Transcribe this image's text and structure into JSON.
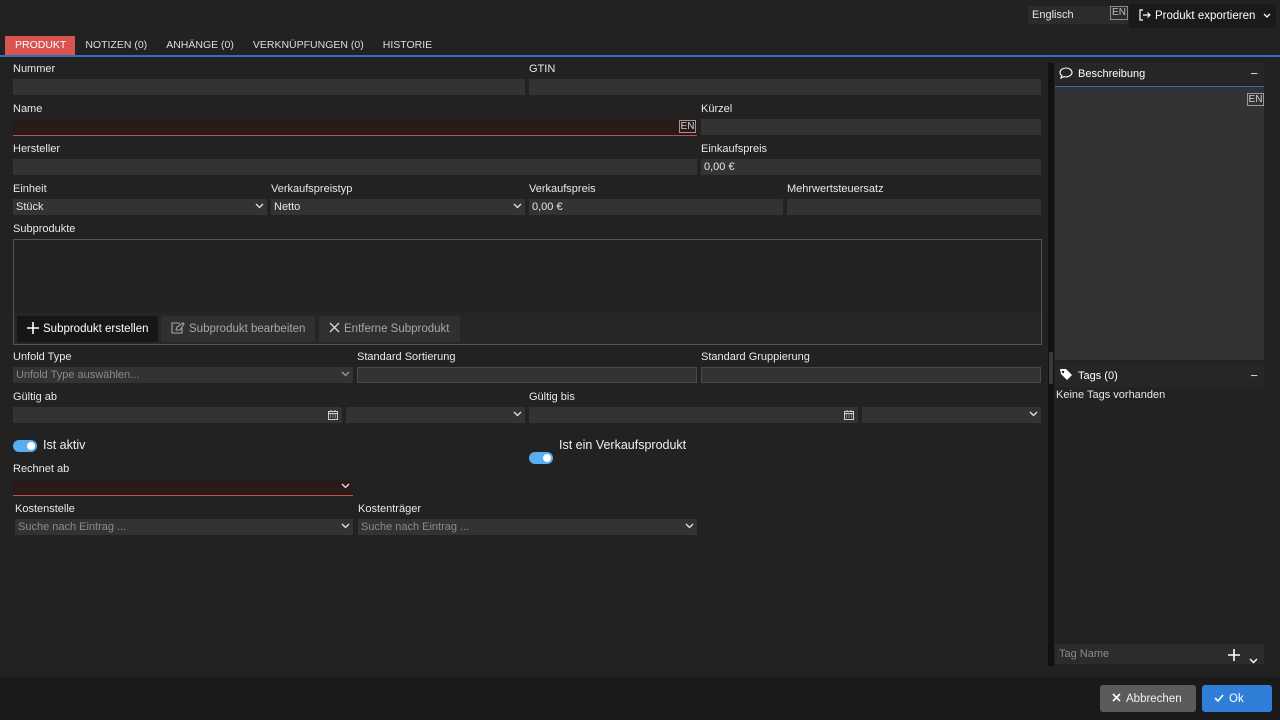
{
  "header": {
    "language": "Englisch",
    "language_code": "EN",
    "export_label": "Produkt exportieren"
  },
  "tabs": [
    {
      "label": "PRODUKT",
      "active": true
    },
    {
      "label": "NOTIZEN (0)"
    },
    {
      "label": "ANHÄNGE (0)"
    },
    {
      "label": "VERKNÜPFUNGEN (0)"
    },
    {
      "label": "HISTORIE"
    }
  ],
  "form": {
    "nummer_label": "Nummer",
    "gtin_label": "GTIN",
    "name_label": "Name",
    "name_lang": "EN",
    "kuerzel_label": "Kürzel",
    "hersteller_label": "Hersteller",
    "einkaufspreis_label": "Einkaufspreis",
    "einkaufspreis_value": "0,00 €",
    "einheit_label": "Einheit",
    "einheit_value": "Stück",
    "verkaufspreistyp_label": "Verkaufspreistyp",
    "verkaufspreistyp_value": "Netto",
    "verkaufspreis_label": "Verkaufspreis",
    "verkaufspreis_value": "0,00 €",
    "mwst_label": "Mehrwertsteuersatz",
    "subprodukte_label": "Subprodukte",
    "subprodukt_erstellen": "Subprodukt erstellen",
    "subprodukt_bearbeiten": "Subprodukt bearbeiten",
    "subprodukt_entfernen": "Entferne Subprodukt",
    "unfold_type_label": "Unfold Type",
    "unfold_type_placeholder": "Unfold Type auswählen...",
    "std_sortierung_label": "Standard Sortierung",
    "std_gruppierung_label": "Standard Gruppierung",
    "gueltig_ab_label": "Gültig ab",
    "gueltig_bis_label": "Gültig bis",
    "ist_aktiv_label": "Ist aktiv",
    "ist_aktiv": true,
    "ist_verkaufsprodukt_label": "Ist ein Verkaufsprodukt",
    "ist_verkaufsprodukt": true,
    "rechnet_ab_label": "Rechnet ab",
    "kostenstelle_label": "Kostenstelle",
    "kostenstelle_placeholder": "Suche nach Eintrag ...",
    "kostentraeger_label": "Kostenträger",
    "kostentraeger_placeholder": "Suche nach Eintrag ..."
  },
  "side": {
    "beschreibung_label": "Beschreibung",
    "beschreibung_lang": "EN",
    "tags_label": "Tags (0)",
    "tags_empty": "Keine Tags vorhanden",
    "tag_name_placeholder": "Tag Name"
  },
  "footer": {
    "cancel_label": "Abbrechen",
    "ok_label": "Ok"
  },
  "colors": {
    "accent": "#2f7fd8",
    "tab_active": "#d9534f",
    "error": "#c0504d",
    "toggle": "#5aaef0"
  }
}
